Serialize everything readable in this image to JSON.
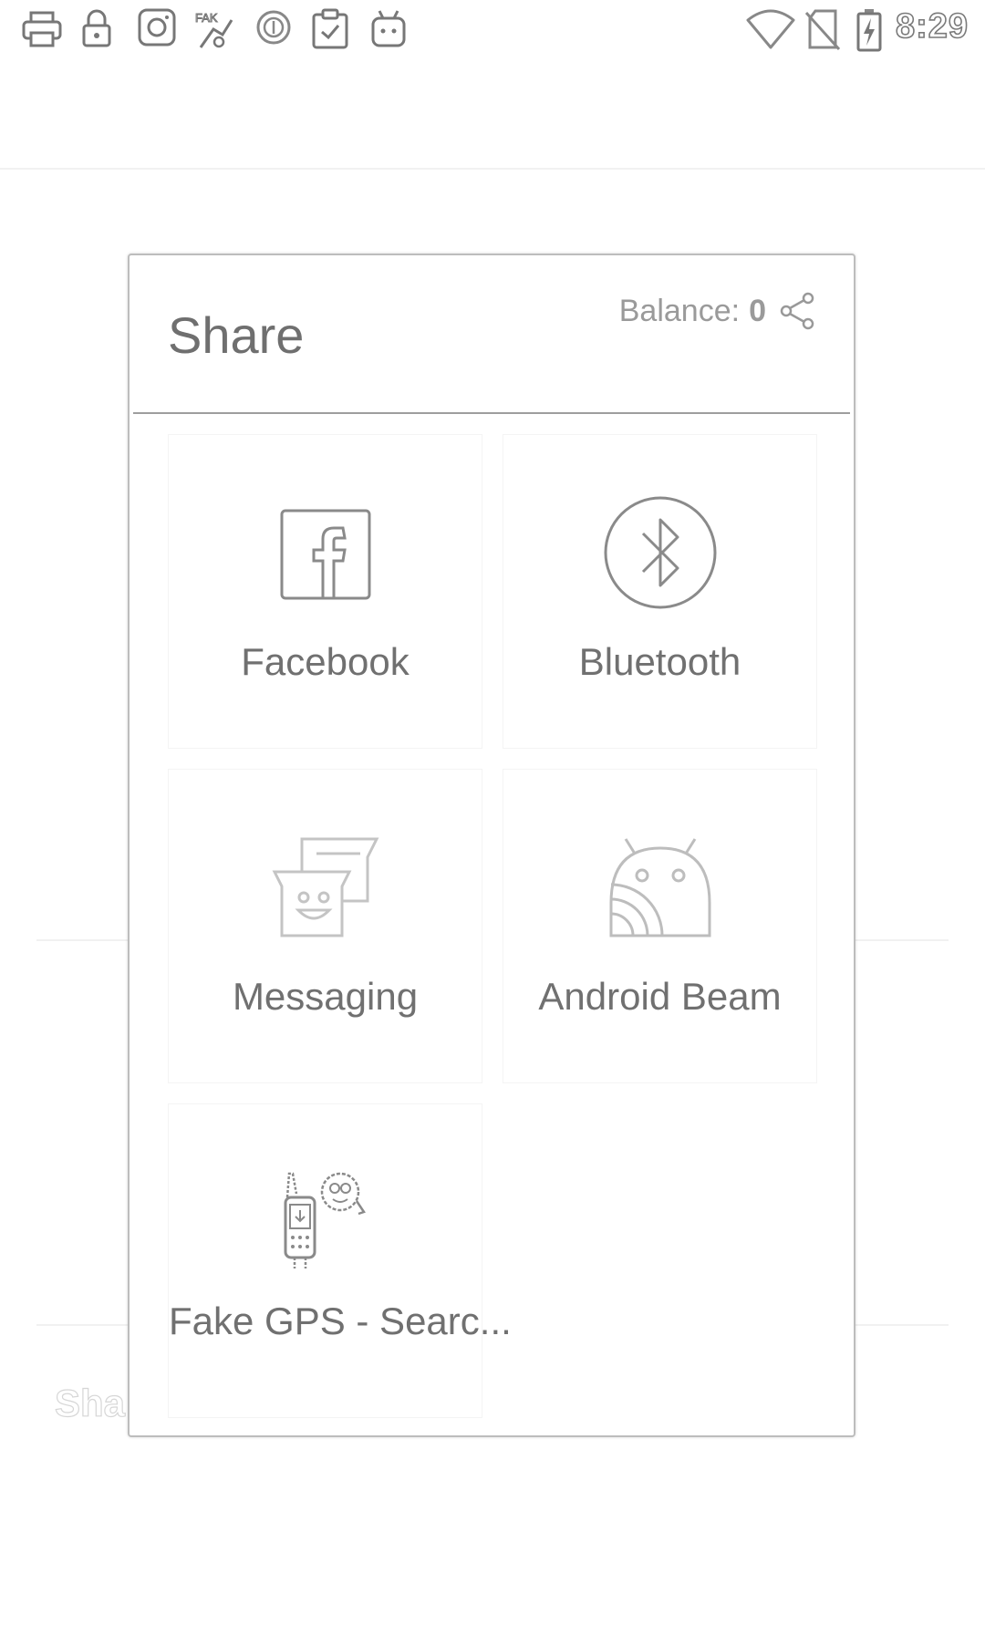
{
  "status_bar": {
    "time": "8:29",
    "left_icons": [
      "printer-icon",
      "lock-icon",
      "instagram-icon",
      "fake-gps-icon",
      "vpn-icon",
      "clipboard-check-icon",
      "android-debug-icon"
    ],
    "right_icons": [
      "wifi-icon",
      "no-sim-icon",
      "battery-charging-icon"
    ]
  },
  "background": {
    "partial_text": "Sha"
  },
  "dialog": {
    "title": "Share",
    "balance_label": "Balance:",
    "balance_value": "0",
    "share_targets": [
      {
        "label": "Facebook",
        "icon": "facebook-icon"
      },
      {
        "label": "Bluetooth",
        "icon": "bluetooth-icon"
      },
      {
        "label": "Messaging",
        "icon": "messaging-icon"
      },
      {
        "label": "Android Beam",
        "icon": "android-beam-icon"
      },
      {
        "label": "Fake GPS - Searc...",
        "icon": "fake-gps-app-icon"
      }
    ]
  }
}
